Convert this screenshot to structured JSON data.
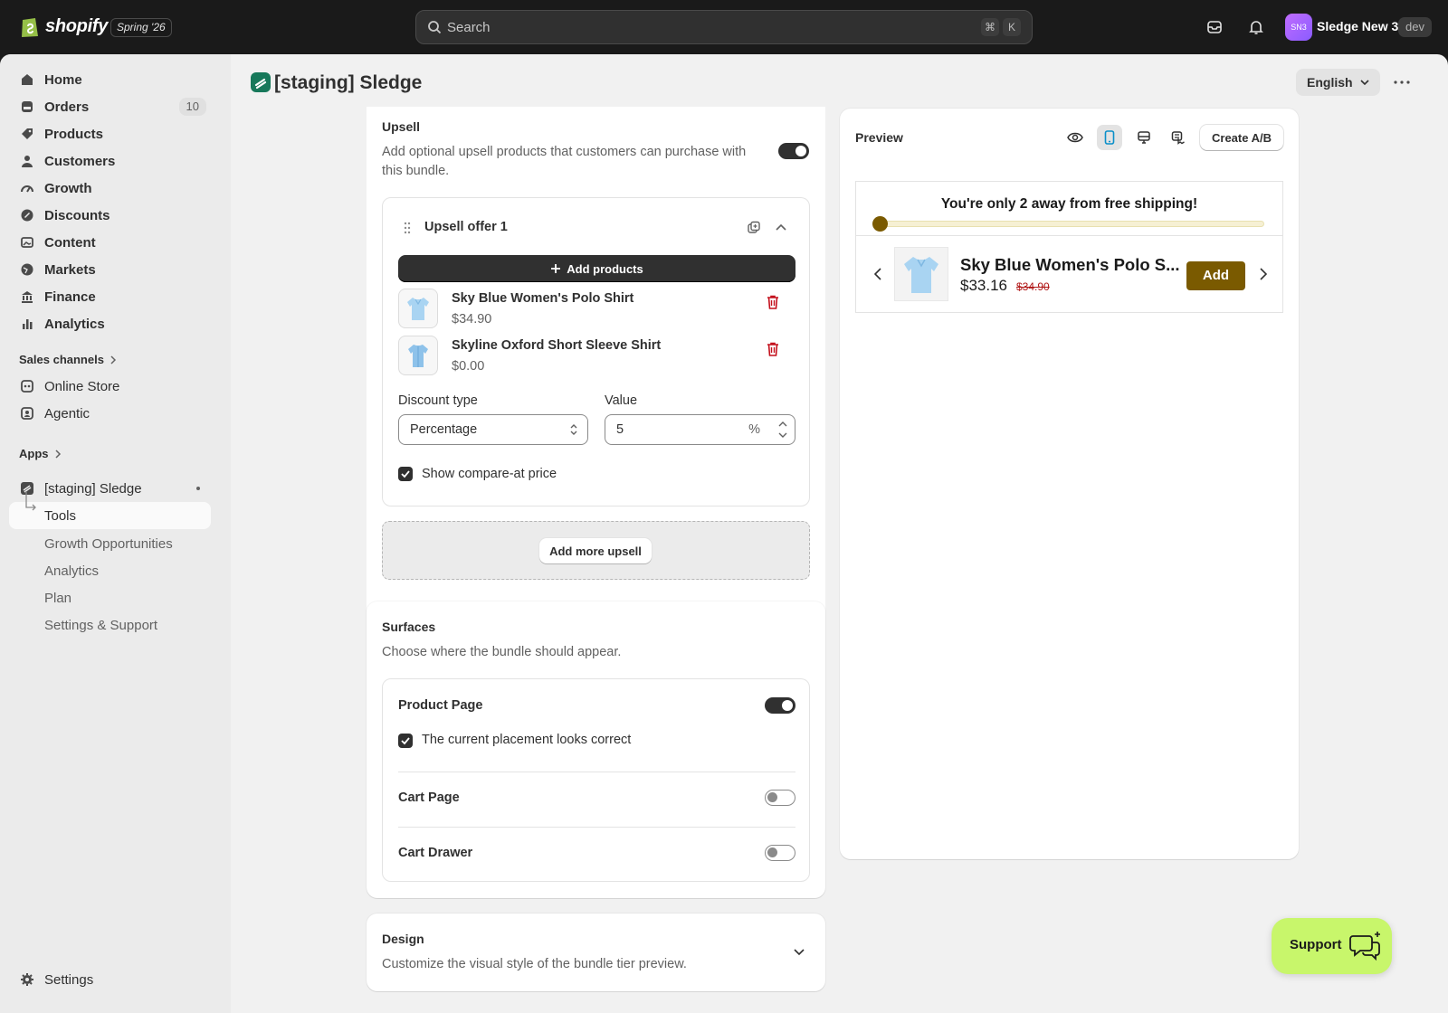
{
  "topbar": {
    "brand": "shopify",
    "edition": "Spring '26",
    "search_placeholder": "Search",
    "shortcut_cmd": "⌘",
    "shortcut_key": "K",
    "avatar_initials": "SN3",
    "store_name": "Sledge New 3",
    "store_badge": "dev"
  },
  "sidebar": {
    "items": [
      {
        "label": "Home",
        "icon": "home-icon"
      },
      {
        "label": "Orders",
        "icon": "orders-icon",
        "count": "10"
      },
      {
        "label": "Products",
        "icon": "tag-icon"
      },
      {
        "label": "Customers",
        "icon": "person-icon"
      },
      {
        "label": "Growth",
        "icon": "gauge-icon"
      },
      {
        "label": "Discounts",
        "icon": "discount-icon"
      },
      {
        "label": "Content",
        "icon": "image-icon"
      },
      {
        "label": "Markets",
        "icon": "globe-icon"
      },
      {
        "label": "Finance",
        "icon": "bank-icon"
      },
      {
        "label": "Analytics",
        "icon": "bar-chart-icon"
      }
    ],
    "sales_channels_label": "Sales channels",
    "channels": [
      {
        "label": "Online Store",
        "icon": "store-icon"
      },
      {
        "label": "Agentic",
        "icon": "agent-icon"
      }
    ],
    "apps_label": "Apps",
    "app_name": "[staging] Sledge",
    "app_subitems": [
      "Tools",
      "Growth Opportunities",
      "Analytics",
      "Plan",
      "Settings & Support"
    ],
    "settings_label": "Settings"
  },
  "page": {
    "title": "[staging] Sledge",
    "language": "English"
  },
  "upsell": {
    "title": "Upsell",
    "description": "Add optional upsell products that customers can purchase with this bundle.",
    "enabled": true,
    "offer_title": "Upsell offer 1",
    "add_products_label": "Add products",
    "products": [
      {
        "name": "Sky Blue Women's Polo Shirt",
        "price": "$34.90"
      },
      {
        "name": "Skyline Oxford Short Sleeve Shirt",
        "price": "$0.00"
      }
    ],
    "discount_type_label": "Discount type",
    "discount_type_value": "Percentage",
    "value_label": "Value",
    "value": "5",
    "value_suffix": "%",
    "compare_at_label": "Show compare-at price",
    "compare_at_checked": true,
    "add_more_label": "Add more upsell"
  },
  "surfaces": {
    "title": "Surfaces",
    "description": "Choose where the bundle should appear.",
    "product_page_label": "Product Page",
    "product_page_on": true,
    "placement_check_label": "The current placement looks correct",
    "cart_page_label": "Cart Page",
    "cart_page_on": false,
    "cart_drawer_label": "Cart Drawer",
    "cart_drawer_on": false
  },
  "design": {
    "title": "Design",
    "description": "Customize the visual style of the bundle tier preview."
  },
  "preview": {
    "title": "Preview",
    "create_ab_label": "Create A/B",
    "shipping_message": "You're only 2 away from free shipping!",
    "shipping_progress": 0,
    "product_name": "Sky Blue Women's Polo S...",
    "sale_price": "$33.16",
    "compare_price": "$34.90",
    "add_label": "Add",
    "accent_color": "#7a5a00"
  },
  "support_label": "Support"
}
